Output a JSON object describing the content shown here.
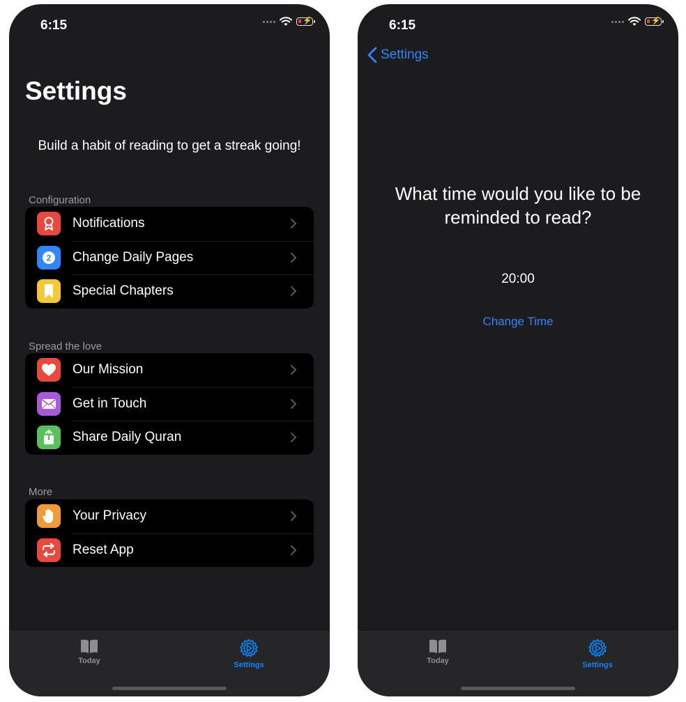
{
  "left_screen": {
    "status_time": "6:15",
    "title": "Settings",
    "subtitle": "Build a habit of reading to get a streak going!",
    "sections": [
      {
        "header": "Configuration",
        "items": [
          {
            "label": "Notifications",
            "icon": "ribbon-icon",
            "color": "#e8483e"
          },
          {
            "label": "Change Daily Pages",
            "icon": "number-two-icon",
            "color": "#2f86ff"
          },
          {
            "label": "Special Chapters",
            "icon": "bookmark-icon",
            "color": "#f4c935"
          }
        ]
      },
      {
        "header": "Spread the love",
        "items": [
          {
            "label": "Our Mission",
            "icon": "heart-icon",
            "color": "#e8483e"
          },
          {
            "label": "Get in Touch",
            "icon": "envelope-icon",
            "color": "#a95ad6"
          },
          {
            "label": "Share Daily Quran",
            "icon": "share-icon",
            "color": "#5ac05d"
          }
        ]
      },
      {
        "header": "More",
        "items": [
          {
            "label": "Your Privacy",
            "icon": "hand-icon",
            "color": "#f19a38"
          },
          {
            "label": "Reset App",
            "icon": "repeat-icon",
            "color": "#e8483e"
          }
        ]
      }
    ],
    "badge_number": "2",
    "tabs": [
      {
        "label": "Today",
        "icon": "book-icon",
        "active": false
      },
      {
        "label": "Settings",
        "icon": "gear-icon",
        "active": true
      }
    ]
  },
  "right_screen": {
    "status_time": "6:15",
    "back_label": "Settings",
    "question": "What time would you like to be reminded to read?",
    "time_value": "20:00",
    "change_time_label": "Change Time",
    "tabs": [
      {
        "label": "Today",
        "icon": "book-icon",
        "active": false
      },
      {
        "label": "Settings",
        "icon": "gear-icon",
        "active": true
      }
    ]
  },
  "colors": {
    "background": "#1c1c1e",
    "accent": "#2f86ff",
    "tabbar": "#262628",
    "battery_low": "#ff3b30"
  }
}
